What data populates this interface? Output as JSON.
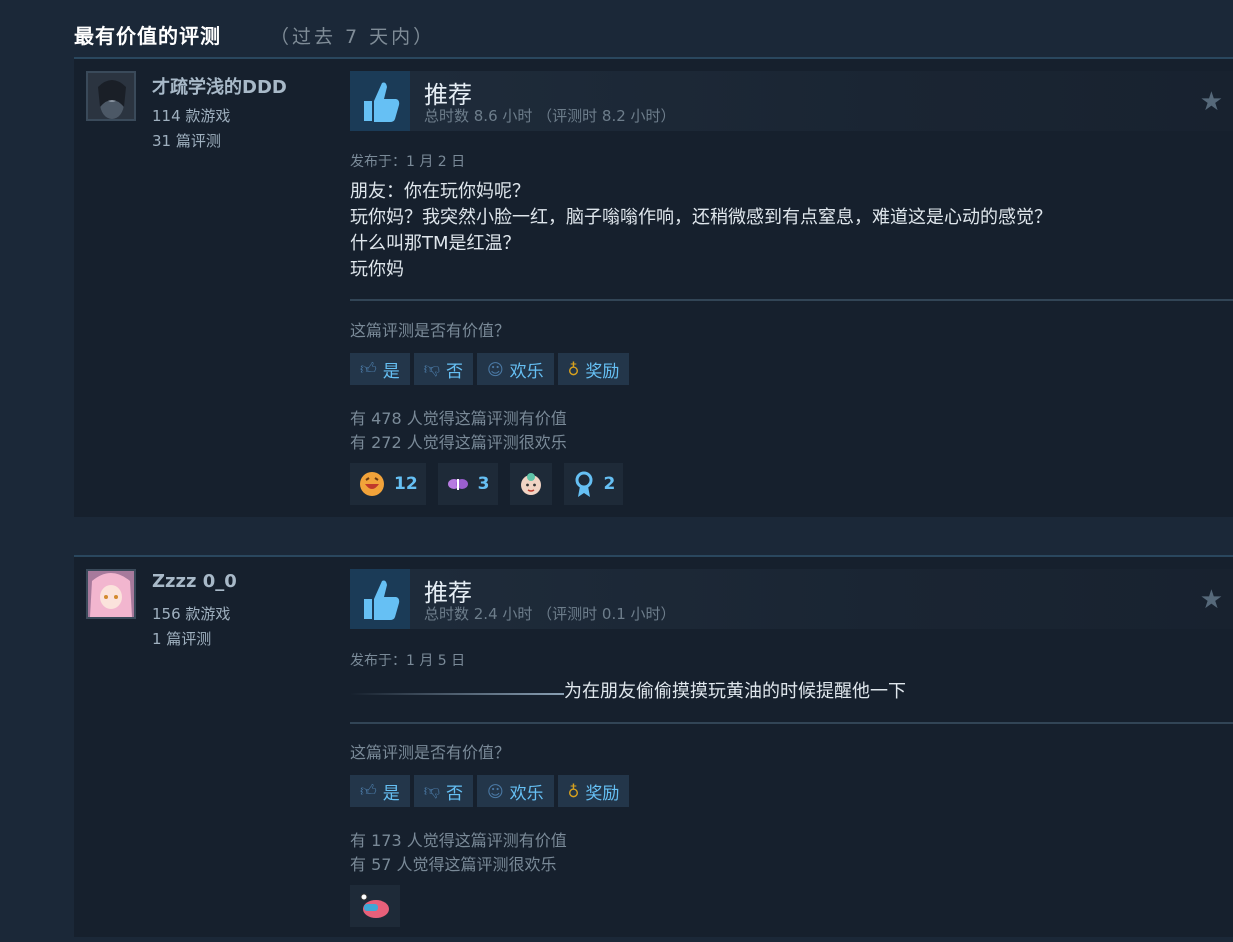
{
  "section": {
    "title": "最有价值的评测",
    "subtitle": "（过去 7 天内）"
  },
  "reviews": [
    {
      "user": {
        "name": "才疏学浅的DDD",
        "games": "114 款游戏",
        "reviews": "31 篇评测"
      },
      "vote": {
        "title": "推荐",
        "hours": "总时数 8.6 小时 （评测时 8.2 小时）"
      },
      "posted": "发布于：1 月 2 日",
      "body": [
        "朋友：你在玩你妈呢？",
        "玩你妈？我突然小脸一红，脑子嗡嗡作响，还稍微感到有点窒息，难道这是心动的感觉？",
        "什么叫那TM是红温？",
        "玩你妈"
      ],
      "helpful_q": "这篇评测是否有价值？",
      "buttons": {
        "yes": "是",
        "no": "否",
        "funny": "欢乐",
        "award": "奖励"
      },
      "counts": [
        "有 478 人觉得这篇评测有价值",
        "有 272 人觉得这篇评测很欢乐"
      ],
      "awards": [
        {
          "icon": "laughing-face-icon",
          "count": "12"
        },
        {
          "icon": "butterfly-icon",
          "count": "3"
        },
        {
          "icon": "baby-face-icon",
          "count": ""
        },
        {
          "icon": "ribbon-medal-icon",
          "count": "2"
        }
      ]
    },
    {
      "user": {
        "name": "Zzzz 0_0",
        "games": "156 款游戏",
        "reviews": "1 篇评测"
      },
      "vote": {
        "title": "推荐",
        "hours": "总时数 2.4 小时 （评测时 0.1 小时）"
      },
      "posted": "发布于：1 月 5 日",
      "body": [
        "为在朋友偷偷摸摸玩黄油的时候提醒他一下"
      ],
      "helpful_q": "这篇评测是否有价值？",
      "buttons": {
        "yes": "是",
        "no": "否",
        "funny": "欢乐",
        "award": "奖励"
      },
      "counts": [
        "有 173 人觉得这篇评测有价值",
        "有 57 人觉得这篇评测很欢乐"
      ],
      "awards": [
        {
          "icon": "brain-goggles-icon",
          "count": ""
        }
      ]
    }
  ],
  "colors": {
    "accent": "#66c0f4",
    "background": "#1b2838",
    "panel": "#16202d"
  }
}
